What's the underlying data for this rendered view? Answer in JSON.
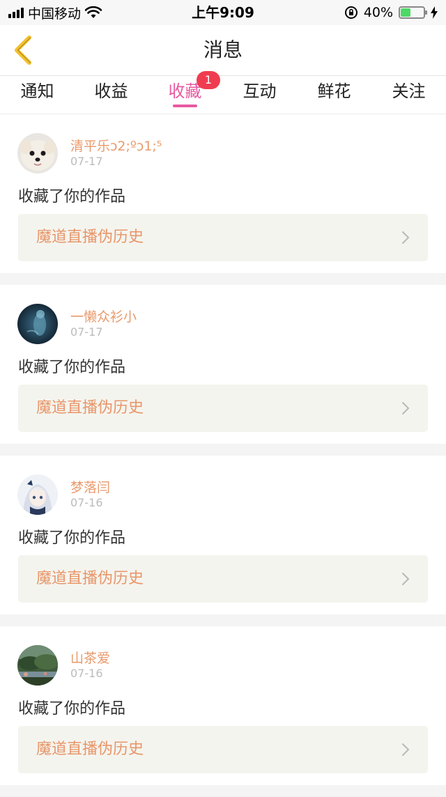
{
  "status_bar": {
    "carrier": "中国移动",
    "time": "上午9:09",
    "battery_text": "40%",
    "battery_level": 0.4,
    "battery_color": "#4cd964"
  },
  "header": {
    "back_icon": "chevron-left-icon",
    "back_color": "#f2c12e",
    "title": "消息"
  },
  "tabs": [
    {
      "label": "通知"
    },
    {
      "label": "收益"
    },
    {
      "label": "收藏",
      "active": true,
      "badge": "1"
    },
    {
      "label": "互动"
    },
    {
      "label": "鲜花"
    },
    {
      "label": "关注"
    }
  ],
  "accent_color": "#e65aa0",
  "messages": [
    {
      "user": "清平乐ↄ2;ºↄ1;⁵",
      "date": "07-17",
      "action": "收藏了你的作品",
      "work": "魔道直播伪历史",
      "avatar": "dog-avatar"
    },
    {
      "user": "一懒众衫小",
      "date": "07-17",
      "action": "收藏了你的作品",
      "work": "魔道直播伪历史",
      "avatar": "dark-figure-avatar"
    },
    {
      "user": "梦落闫",
      "date": "07-16",
      "action": "收藏了你的作品",
      "work": "魔道直播伪历史",
      "avatar": "anime-girl-avatar"
    },
    {
      "user": "山茶爱",
      "date": "07-16",
      "action": "收藏了你的作品",
      "work": "魔道直播伪历史",
      "avatar": "landscape-avatar"
    }
  ]
}
